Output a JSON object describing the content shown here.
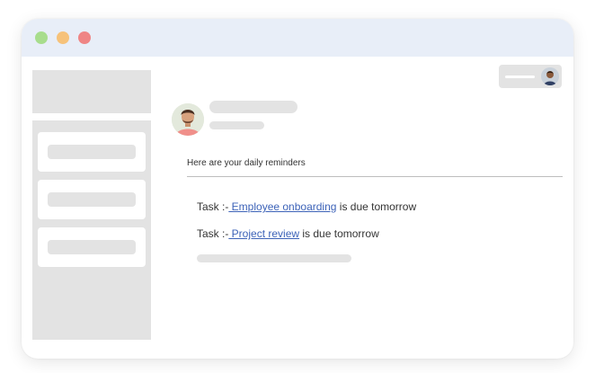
{
  "window": {
    "traffic_lights": [
      {
        "name": "green",
        "color": "#a8dd8d"
      },
      {
        "name": "yellow",
        "color": "#f6c27a"
      },
      {
        "name": "red",
        "color": "#ef8585"
      }
    ]
  },
  "email": {
    "subject": "Here are your daily reminders",
    "tasks": [
      {
        "prefix": "Task :-",
        "link": " Employee onboarding",
        "suffix": " is due tomorrow"
      },
      {
        "prefix": "Task :-",
        "link": " Project review",
        "suffix": " is due tomorrow"
      }
    ]
  },
  "icons": {
    "sender_avatar": "person-avatar-icon",
    "account_avatar": "person-avatar-icon"
  }
}
